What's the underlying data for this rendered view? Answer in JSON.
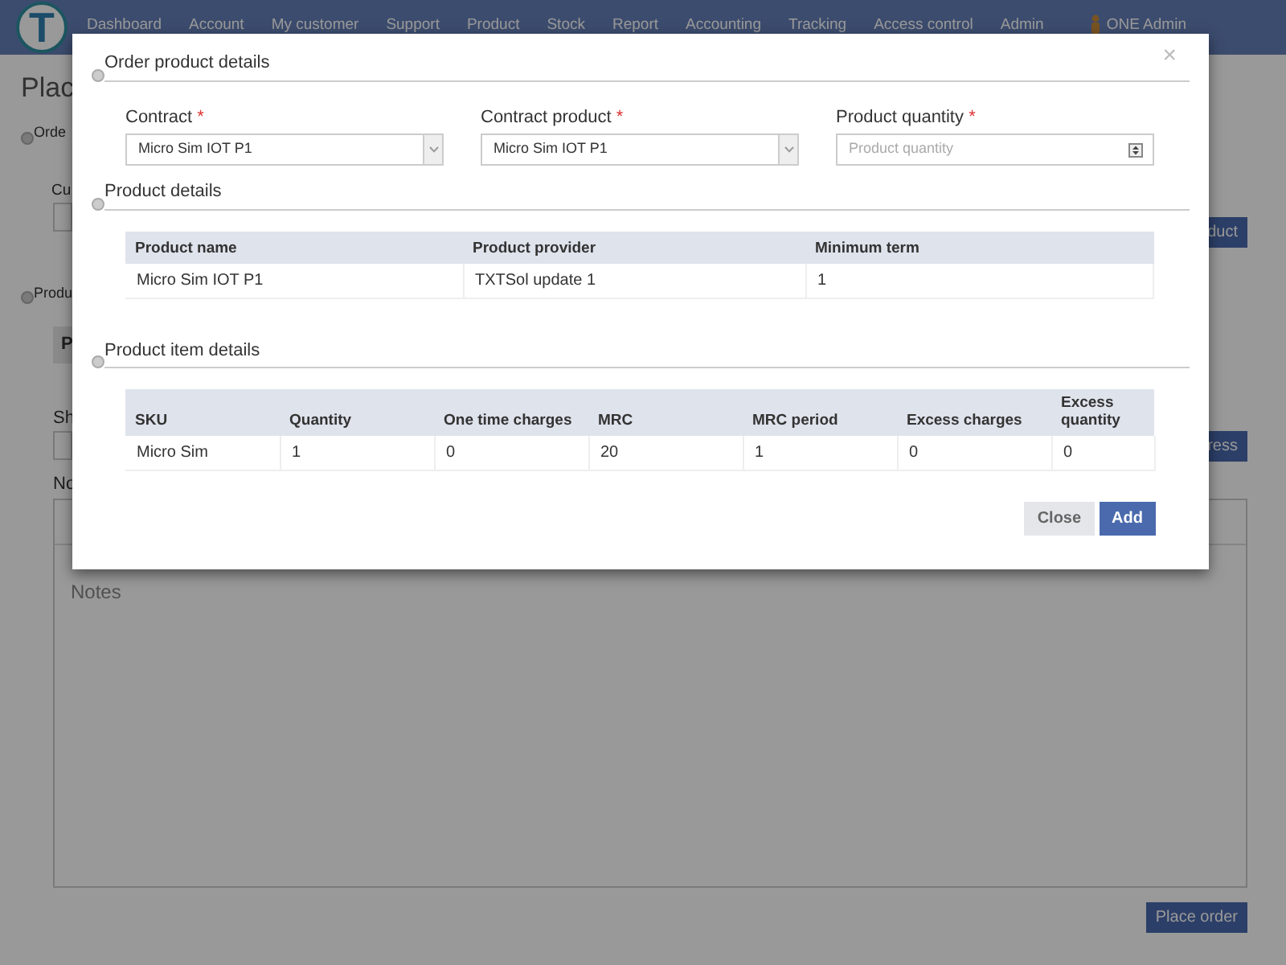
{
  "navbar": {
    "logo": "T",
    "items": [
      "Dashboard",
      "Account",
      "My customer",
      "Support",
      "Product",
      "Stock",
      "Report",
      "Accounting",
      "Tracking",
      "Access control",
      "Admin"
    ],
    "user": "ONE Admin"
  },
  "background": {
    "title": "Plac",
    "section_1": "Orde",
    "field_label_1": "Cu",
    "button_1": "duct",
    "section_2": "Produ",
    "table_header": "P",
    "field_label_2": "Sh",
    "button_2": "ress",
    "notes_label": "No",
    "notes_placeholder": "Notes",
    "place_order_button": "Place order"
  },
  "modal": {
    "title": "Order product details",
    "close": "×",
    "fields": [
      {
        "label": "Contract",
        "required": true,
        "required_mark": "*",
        "kind": "select",
        "value": "Micro Sim IOT P1"
      },
      {
        "label": "Contract product",
        "required": true,
        "required_mark": "*",
        "kind": "select",
        "value": "Micro Sim IOT P1"
      },
      {
        "label": "Product quantity",
        "required": true,
        "required_mark": "*",
        "kind": "number",
        "placeholder": "Product quantity"
      }
    ],
    "product_details": {
      "title": "Product details",
      "columns": [
        "Product name",
        "Product provider",
        "Minimum term"
      ],
      "rows": [
        [
          "Micro Sim IOT P1",
          "TXTSol update 1",
          "1"
        ]
      ]
    },
    "item_details": {
      "title": "Product item details",
      "columns": [
        "SKU",
        "Quantity",
        "One time charges",
        "MRC",
        "MRC period",
        "Excess charges",
        "Excess quantity"
      ],
      "rows": [
        [
          "Micro Sim",
          "1",
          "0",
          "20",
          "1",
          "0",
          "0"
        ]
      ]
    },
    "buttons": [
      {
        "label": "Close",
        "kind": "secondary"
      },
      {
        "label": "Add",
        "kind": "primary"
      }
    ]
  }
}
